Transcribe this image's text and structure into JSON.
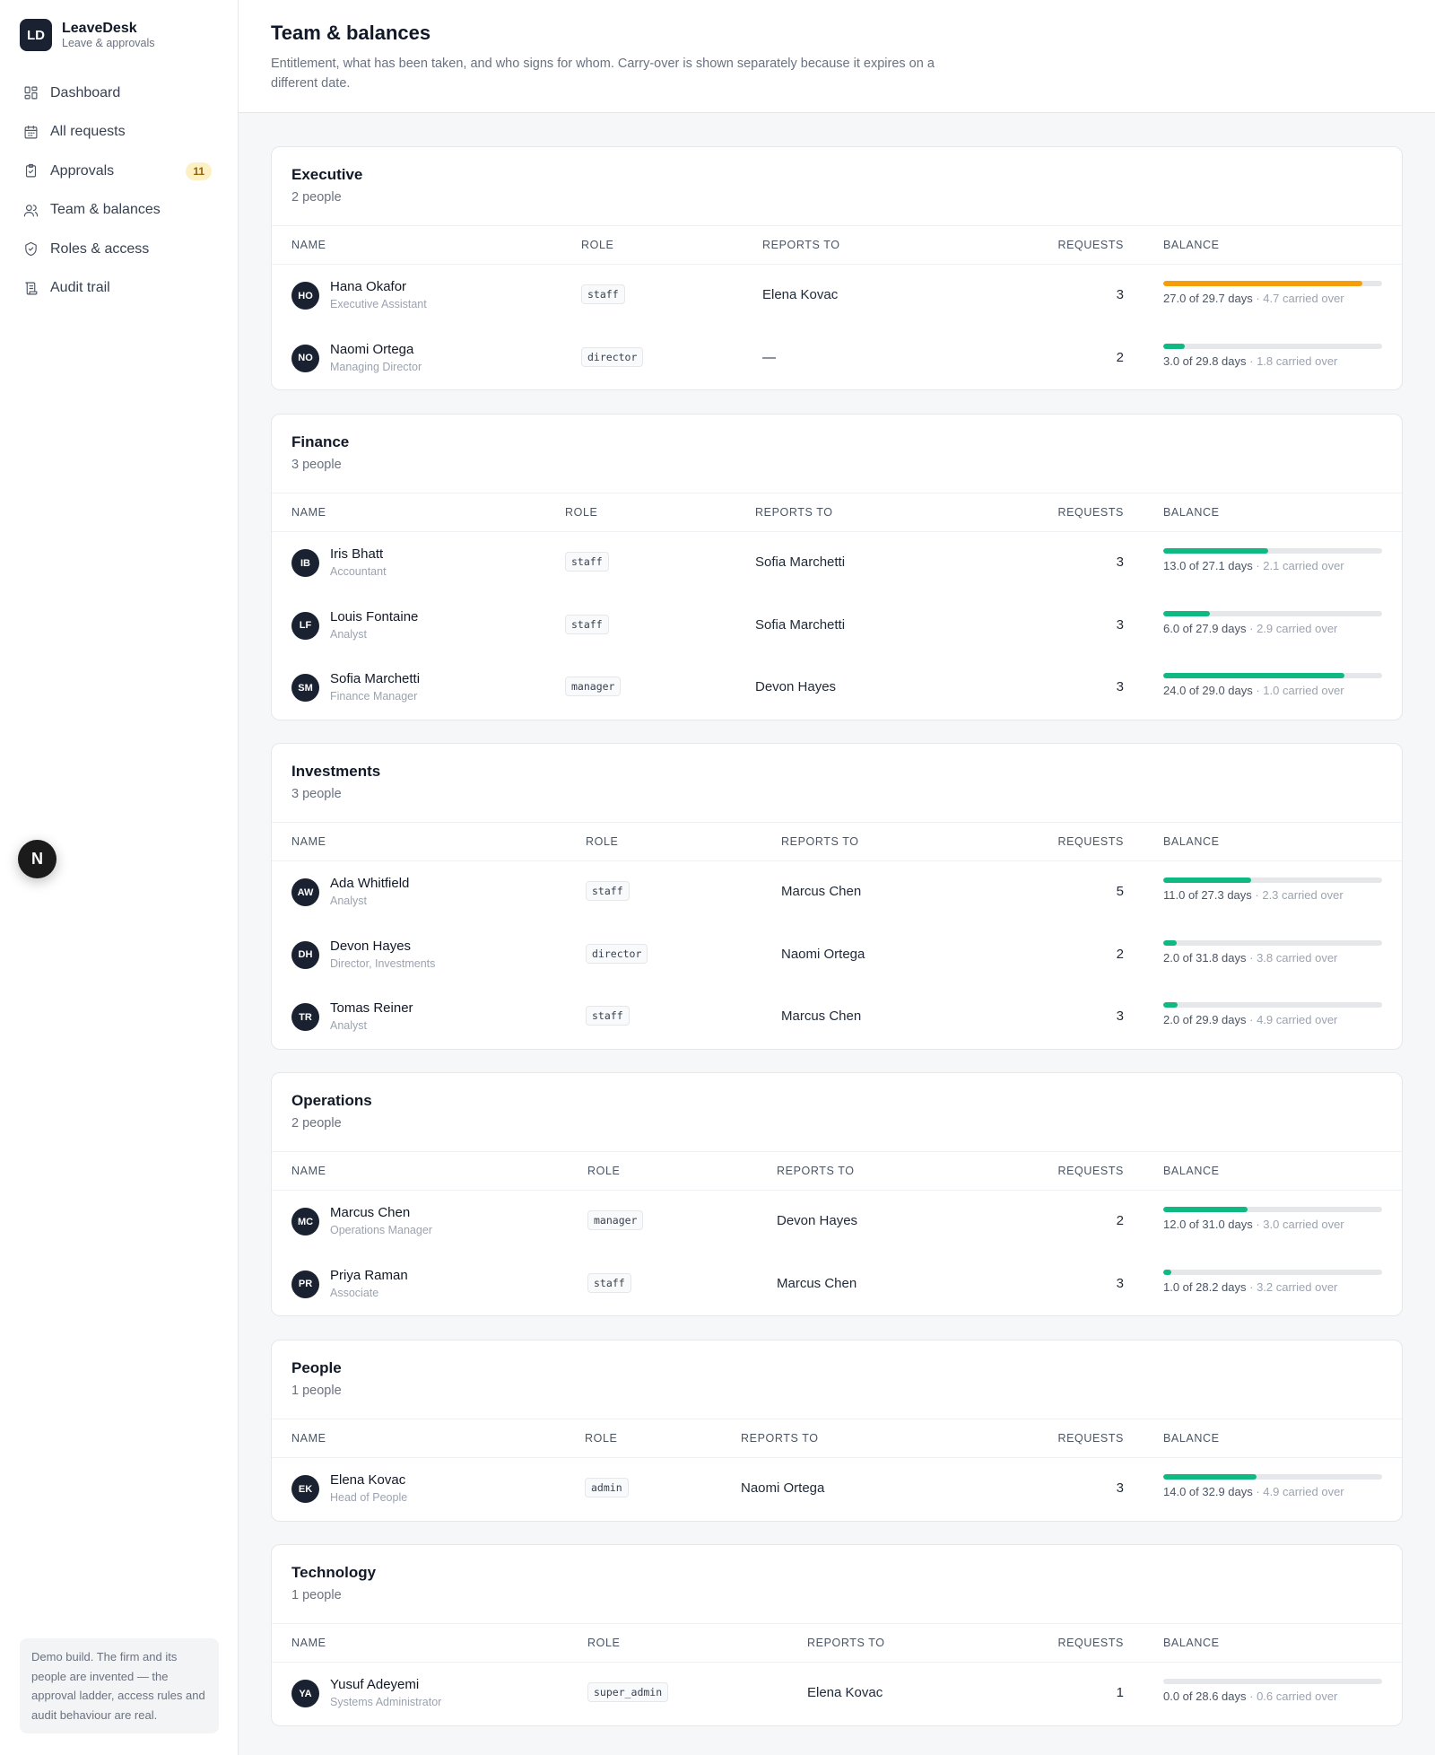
{
  "brand": {
    "logo": "LD",
    "name": "LeaveDesk",
    "subtitle": "Leave & approvals"
  },
  "nav": [
    {
      "label": "Dashboard",
      "icon": "dashboard-icon"
    },
    {
      "label": "All requests",
      "icon": "calendar-icon"
    },
    {
      "label": "Approvals",
      "icon": "clipboard-check-icon",
      "badge": "11"
    },
    {
      "label": "Team & balances",
      "icon": "users-icon"
    },
    {
      "label": "Roles & access",
      "icon": "shield-icon"
    },
    {
      "label": "Audit trail",
      "icon": "scroll-icon"
    }
  ],
  "next_badge": "N",
  "demo_note": "Demo build. The firm and its people are invented — the approval ladder, access rules and audit behaviour are real.",
  "header": {
    "title": "Team & balances",
    "description": "Entitlement, what has been taken, and who signs for whom. Carry-over is shown separately because it expires on a different date."
  },
  "columns": {
    "name": "NAME",
    "role": "ROLE",
    "reports_to": "REPORTS TO",
    "requests": "REQUESTS",
    "balance": "BALANCE"
  },
  "colors": {
    "accent": "#10b981",
    "warning": "#f59e0b",
    "avatar": "#1a2232"
  },
  "departments": [
    {
      "name": "Executive",
      "count": "2 people",
      "people": [
        {
          "initials": "HO",
          "name": "Hana Okafor",
          "title": "Executive Assistant",
          "role": "staff",
          "reports_to": "Elena Kovac",
          "requests": "3",
          "balance_main": "27.0 of 29.7 days",
          "carried": " · 4.7 carried over",
          "used_fraction": 0.909,
          "bar_color": "#f59e0b"
        },
        {
          "initials": "NO",
          "name": "Naomi Ortega",
          "title": "Managing Director",
          "role": "director",
          "reports_to": "—",
          "requests": "2",
          "balance_main": "3.0 of 29.8 days",
          "carried": " · 1.8 carried over",
          "used_fraction": 0.1,
          "bar_color": "#10b981"
        }
      ]
    },
    {
      "name": "Finance",
      "count": "3 people",
      "people": [
        {
          "initials": "IB",
          "name": "Iris Bhatt",
          "title": "Accountant",
          "role": "staff",
          "reports_to": "Sofia Marchetti",
          "requests": "3",
          "balance_main": "13.0 of 27.1 days",
          "carried": " · 2.1 carried over",
          "used_fraction": 0.48,
          "bar_color": "#10b981"
        },
        {
          "initials": "LF",
          "name": "Louis Fontaine",
          "title": "Analyst",
          "role": "staff",
          "reports_to": "Sofia Marchetti",
          "requests": "3",
          "balance_main": "6.0 of 27.9 days",
          "carried": " · 2.9 carried over",
          "used_fraction": 0.215,
          "bar_color": "#10b981"
        },
        {
          "initials": "SM",
          "name": "Sofia Marchetti",
          "title": "Finance Manager",
          "role": "manager",
          "reports_to": "Devon Hayes",
          "requests": "3",
          "balance_main": "24.0 of 29.0 days",
          "carried": " · 1.0 carried over",
          "used_fraction": 0.828,
          "bar_color": "#10b981"
        }
      ]
    },
    {
      "name": "Investments",
      "count": "3 people",
      "people": [
        {
          "initials": "AW",
          "name": "Ada Whitfield",
          "title": "Analyst",
          "role": "staff",
          "reports_to": "Marcus Chen",
          "requests": "5",
          "balance_main": "11.0 of 27.3 days",
          "carried": " · 2.3 carried over",
          "used_fraction": 0.403,
          "bar_color": "#10b981"
        },
        {
          "initials": "DH",
          "name": "Devon Hayes",
          "title": "Director, Investments",
          "role": "director",
          "reports_to": "Naomi Ortega",
          "requests": "2",
          "balance_main": "2.0 of 31.8 days",
          "carried": " · 3.8 carried over",
          "used_fraction": 0.063,
          "bar_color": "#10b981"
        },
        {
          "initials": "TR",
          "name": "Tomas Reiner",
          "title": "Analyst",
          "role": "staff",
          "reports_to": "Marcus Chen",
          "requests": "3",
          "balance_main": "2.0 of 29.9 days",
          "carried": " · 4.9 carried over",
          "used_fraction": 0.067,
          "bar_color": "#10b981"
        }
      ]
    },
    {
      "name": "Operations",
      "count": "2 people",
      "people": [
        {
          "initials": "MC",
          "name": "Marcus Chen",
          "title": "Operations Manager",
          "role": "manager",
          "reports_to": "Devon Hayes",
          "requests": "2",
          "balance_main": "12.0 of 31.0 days",
          "carried": " · 3.0 carried over",
          "used_fraction": 0.387,
          "bar_color": "#10b981"
        },
        {
          "initials": "PR",
          "name": "Priya Raman",
          "title": "Associate",
          "role": "staff",
          "reports_to": "Marcus Chen",
          "requests": "3",
          "balance_main": "1.0 of 28.2 days",
          "carried": " · 3.2 carried over",
          "used_fraction": 0.035,
          "bar_color": "#10b981"
        }
      ]
    },
    {
      "name": "People",
      "count": "1 people",
      "people": [
        {
          "initials": "EK",
          "name": "Elena Kovac",
          "title": "Head of People",
          "role": "admin",
          "reports_to": "Naomi Ortega",
          "requests": "3",
          "balance_main": "14.0 of 32.9 days",
          "carried": " · 4.9 carried over",
          "used_fraction": 0.426,
          "bar_color": "#10b981"
        }
      ]
    },
    {
      "name": "Technology",
      "count": "1 people",
      "people": [
        {
          "initials": "YA",
          "name": "Yusuf Adeyemi",
          "title": "Systems Administrator",
          "role": "super_admin",
          "reports_to": "Elena Kovac",
          "requests": "1",
          "balance_main": "0.0 of 28.6 days",
          "carried": " · 0.6 carried over",
          "used_fraction": 0.0,
          "bar_color": "#10b981"
        }
      ]
    }
  ]
}
